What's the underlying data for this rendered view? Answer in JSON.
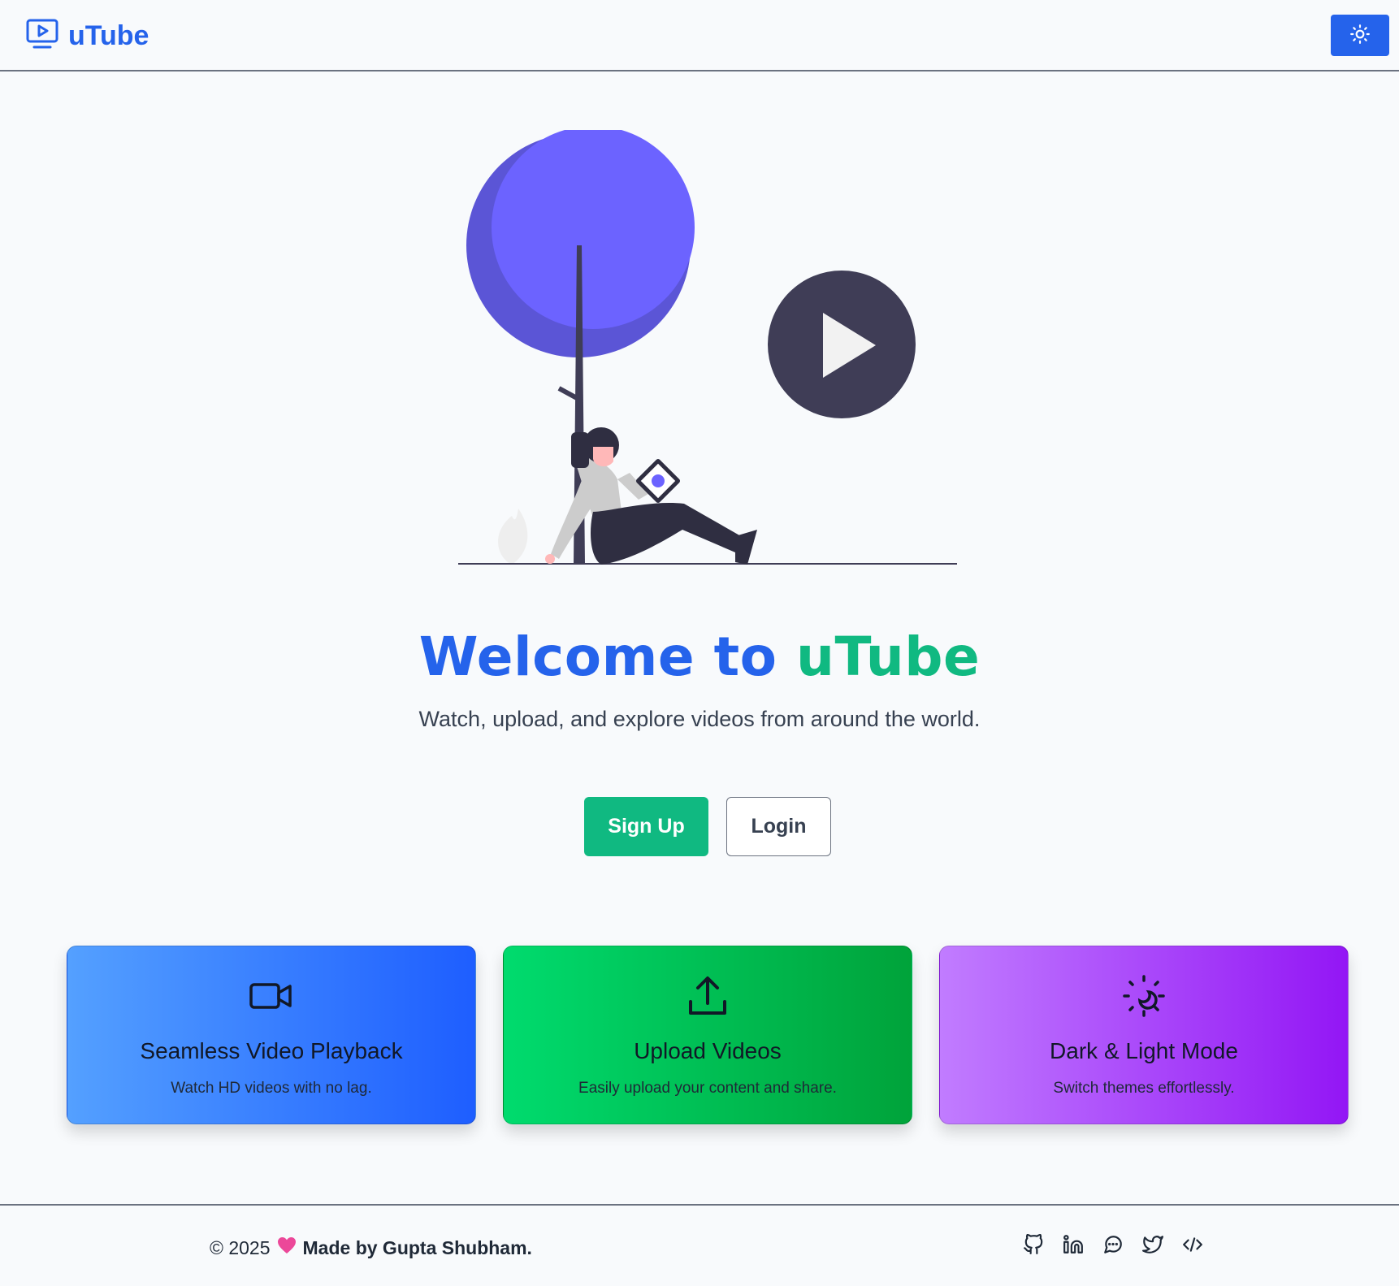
{
  "header": {
    "brand_name": "uTube",
    "logo_icon": "tv-play-icon",
    "theme_toggle_icon": "sun-icon"
  },
  "hero": {
    "illustration": "woman-watching-video-illustration",
    "title_part1": "Welcome to",
    "title_part2": "uTube",
    "subtitle": "Watch, upload, and explore videos from around the world.",
    "signup_label": "Sign Up",
    "login_label": "Login"
  },
  "features": [
    {
      "icon": "video-camera-icon",
      "title": "Seamless Video Playback",
      "description": "Watch HD videos with no lag."
    },
    {
      "icon": "upload-icon",
      "title": "Upload Videos",
      "description": "Easily upload your content and share."
    },
    {
      "icon": "sun-moon-icon",
      "title": "Dark & Light Mode",
      "description": "Switch themes effortlessly."
    }
  ],
  "footer": {
    "copyright": "© 2025",
    "heart_icon": "heart-icon",
    "made_by": "Made by Gupta Shubham.",
    "social_icons": [
      "github-icon",
      "linkedin-icon",
      "chat-icon",
      "twitter-icon",
      "code-icon"
    ]
  },
  "colors": {
    "primary": "#2563eb",
    "accent_green": "#10b981",
    "background": "#f8fafc",
    "heart": "#ec4899"
  }
}
